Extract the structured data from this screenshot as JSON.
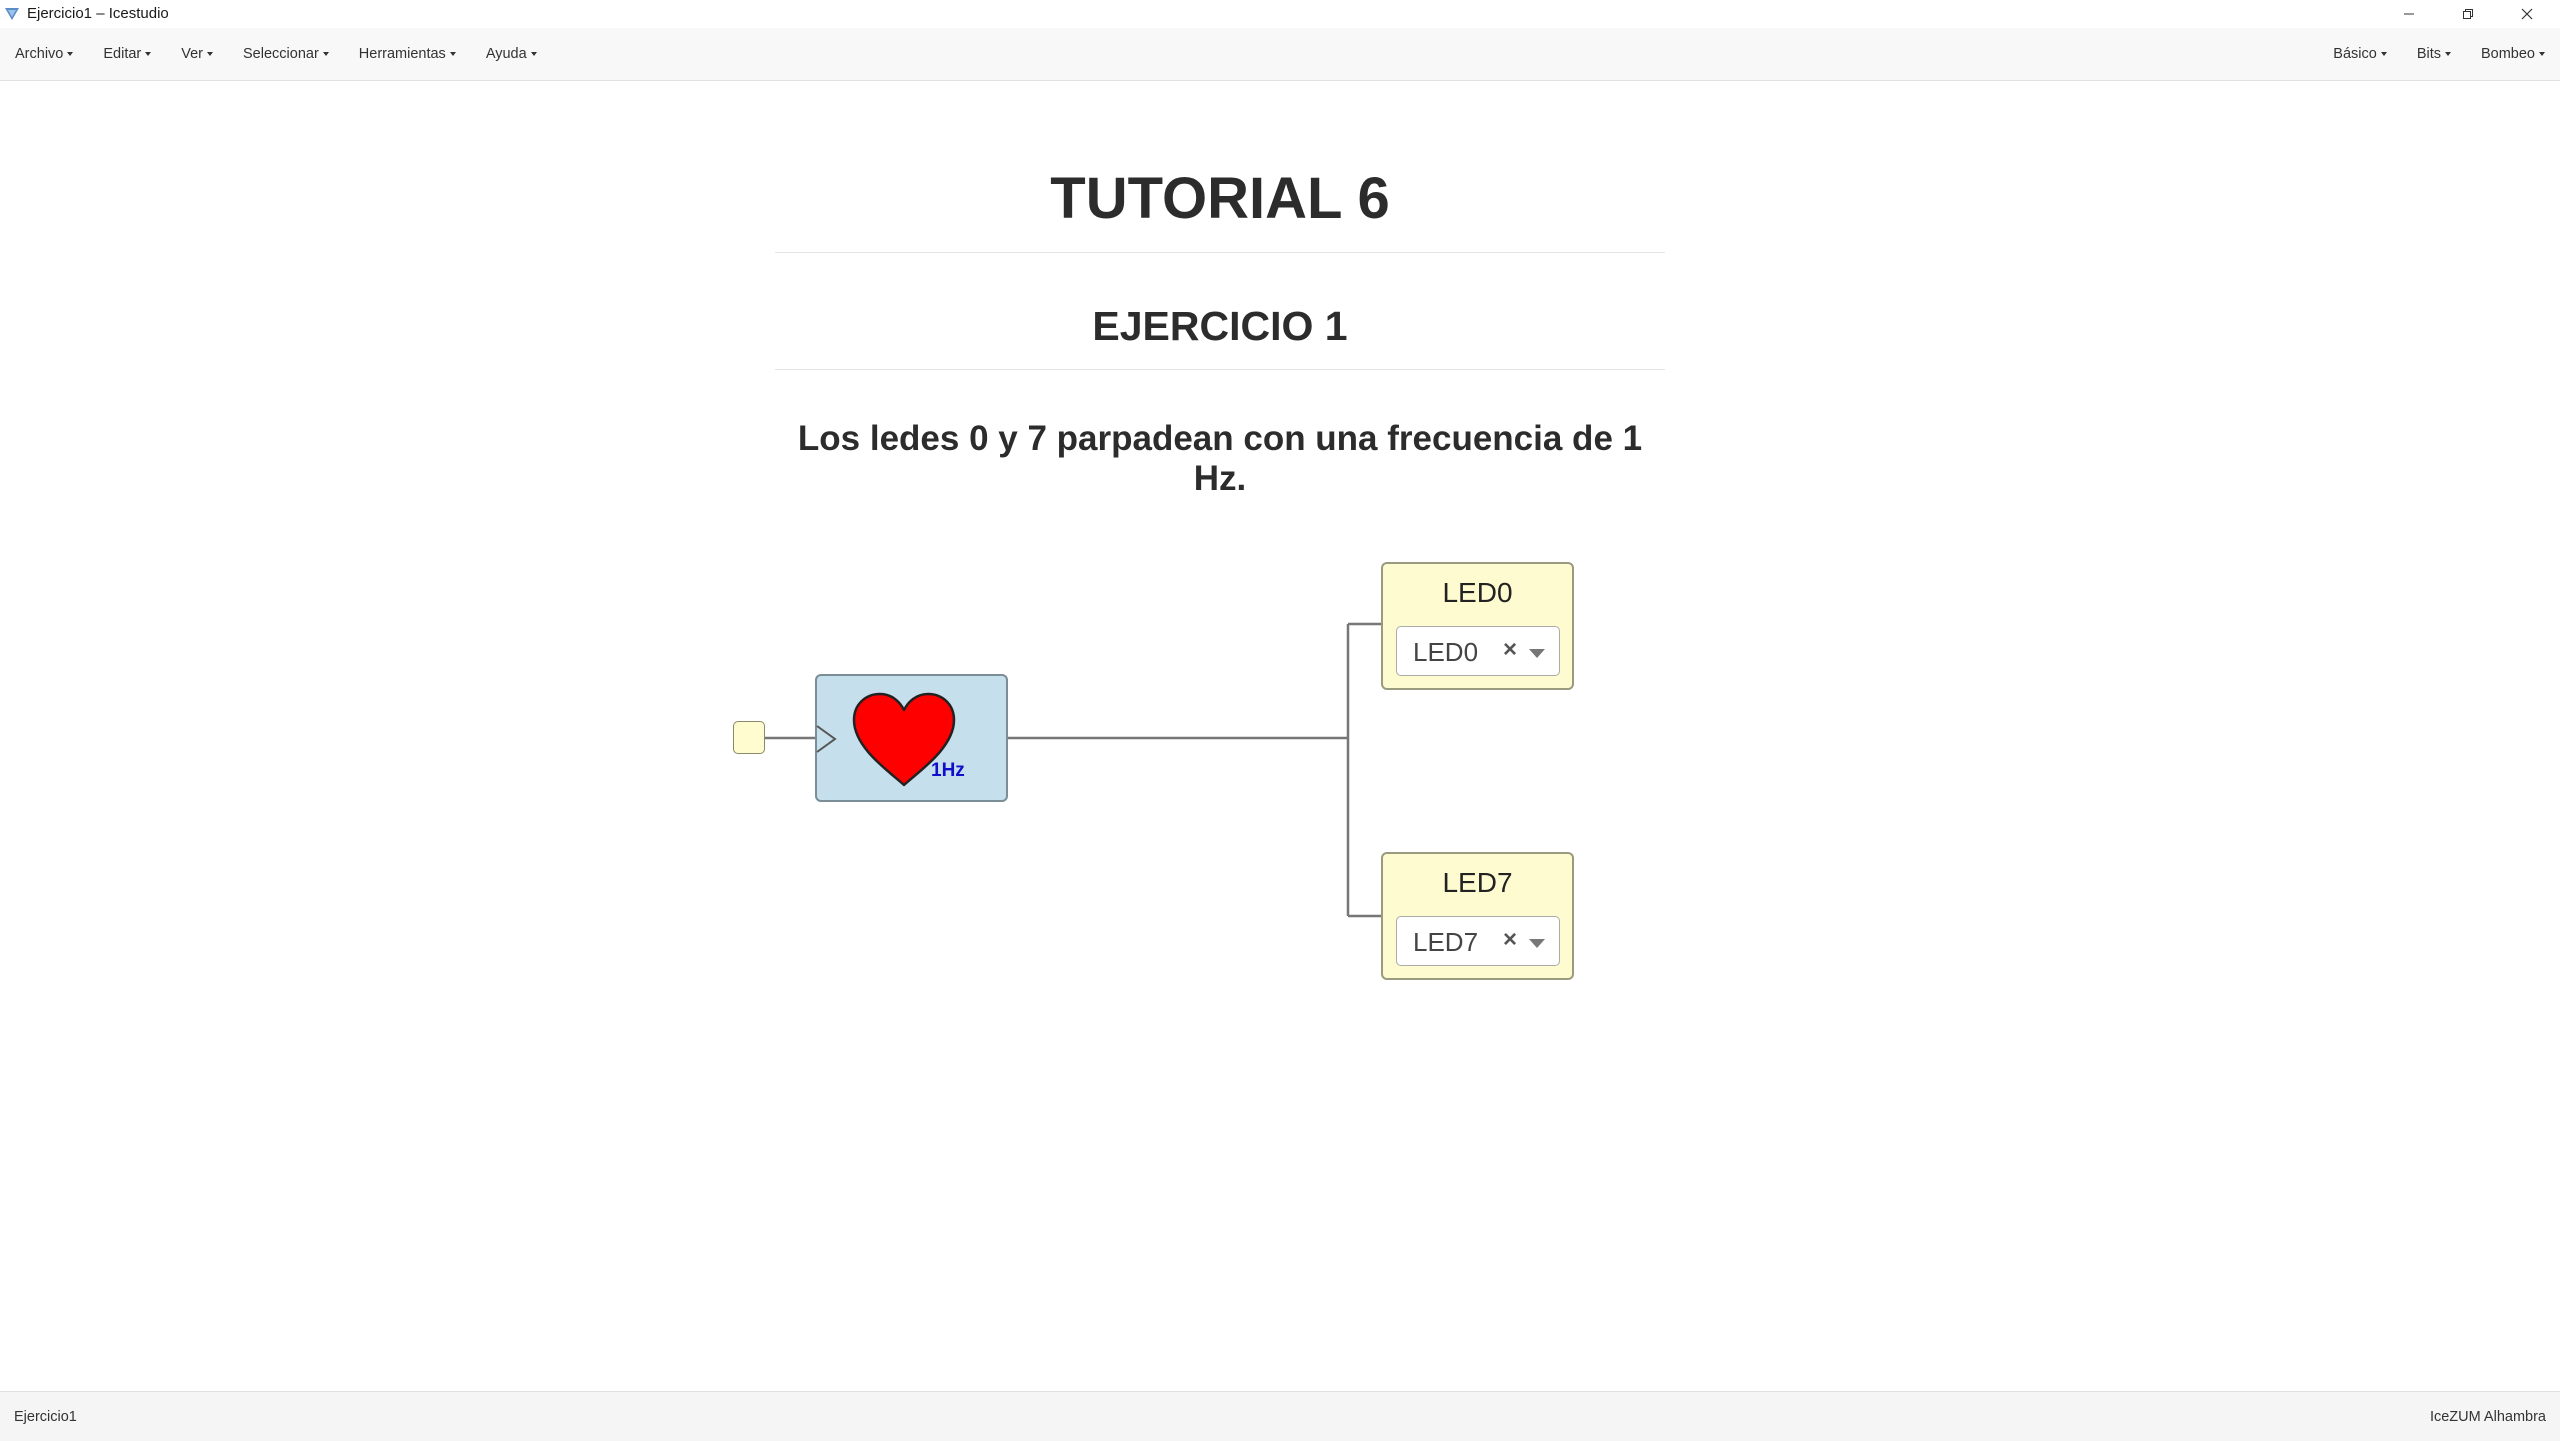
{
  "window": {
    "title": "Ejercicio1 – Icestudio"
  },
  "menubar": {
    "left": [
      "Archivo",
      "Editar",
      "Ver",
      "Seleccionar",
      "Herramientas",
      "Ayuda"
    ],
    "right": [
      "Básico",
      "Bits",
      "Bombeo"
    ]
  },
  "content": {
    "title": "TUTORIAL 6",
    "subtitle": "EJERCICIO 1",
    "description": "Los ledes 0 y 7 parpadean con una frecuencia de 1 Hz."
  },
  "circuit": {
    "clock": {
      "label": "1Hz",
      "color": "#ff0000",
      "block_color": "#c6dfec"
    },
    "leds": [
      {
        "name": "LED0",
        "pin": "LED0"
      },
      {
        "name": "LED7",
        "pin": "LED7"
      }
    ],
    "wire_color": "#777777"
  },
  "statusbar": {
    "left": "Ejercicio1",
    "right": "IceZUM Alhambra"
  }
}
